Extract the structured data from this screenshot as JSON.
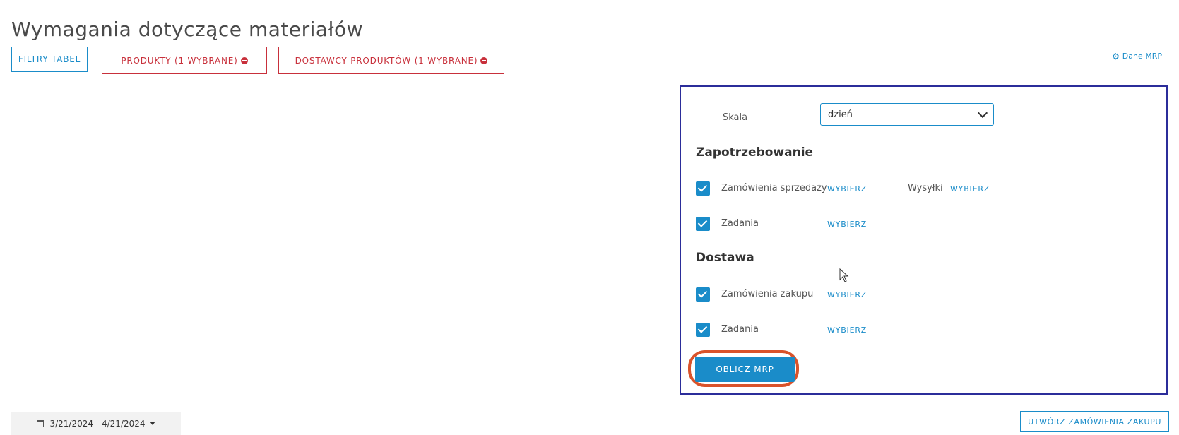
{
  "page": {
    "title": "Wymagania dotyczące materiałów"
  },
  "filters": {
    "table_filters_label": "FILTRY TABEL",
    "products_label": "PRODUKTY (1 WYBRANE)",
    "suppliers_label": "DOSTAWCY PRODUKTÓW (1 WYBRANE)"
  },
  "mrp_data_link": "Dane MRP",
  "panel": {
    "scale_label": "Skala",
    "scale_value": "dzień",
    "demand_title": "Zapotrzebowanie",
    "demand_rows": [
      {
        "label": "Zamówienia sprzedaży",
        "action": "WYBIERZ",
        "checked": true
      },
      {
        "label": "Zadania",
        "action": "WYBIERZ",
        "checked": true
      }
    ],
    "shipments_label": "Wysyłki",
    "shipments_action": "WYBIERZ",
    "supply_title": "Dostawa",
    "supply_rows": [
      {
        "label": "Zamówienia zakupu",
        "action": "WYBIERZ",
        "checked": true
      },
      {
        "label": "Zadania",
        "action": "WYBIERZ",
        "checked": true
      }
    ],
    "calculate_label": "OBLICZ MRP"
  },
  "date_range": "3/21/2024 - 4/21/2024",
  "create_po_label": "UTWÓRZ ZAMÓWIENIA ZAKUPU",
  "colors": {
    "accent": "#1a8cc9",
    "danger": "#c8303b",
    "panel_border": "#2b2d9a",
    "highlight": "#d9532b"
  }
}
